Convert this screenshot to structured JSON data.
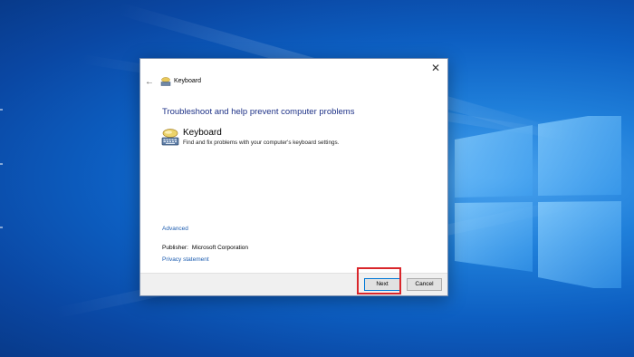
{
  "dialog": {
    "window_title": "Keyboard",
    "close_glyph": "✕",
    "back_glyph": "←",
    "heading": "Troubleshoot and help prevent computer problems",
    "item": {
      "name": "Keyboard",
      "description": "Find and fix problems with your computer's keyboard settings.",
      "icon": "keyboard-troubleshooter-icon"
    },
    "advanced_link": "Advanced",
    "publisher_label": "Publisher:",
    "publisher_value": "Microsoft Corporation",
    "privacy_link": "Privacy statement",
    "buttons": {
      "next": "Next",
      "cancel": "Cancel"
    }
  },
  "colors": {
    "heading": "#1e3287",
    "link": "#1d5db0",
    "highlight": "#d9262b",
    "desktop_blue": "#0d5fc2"
  }
}
